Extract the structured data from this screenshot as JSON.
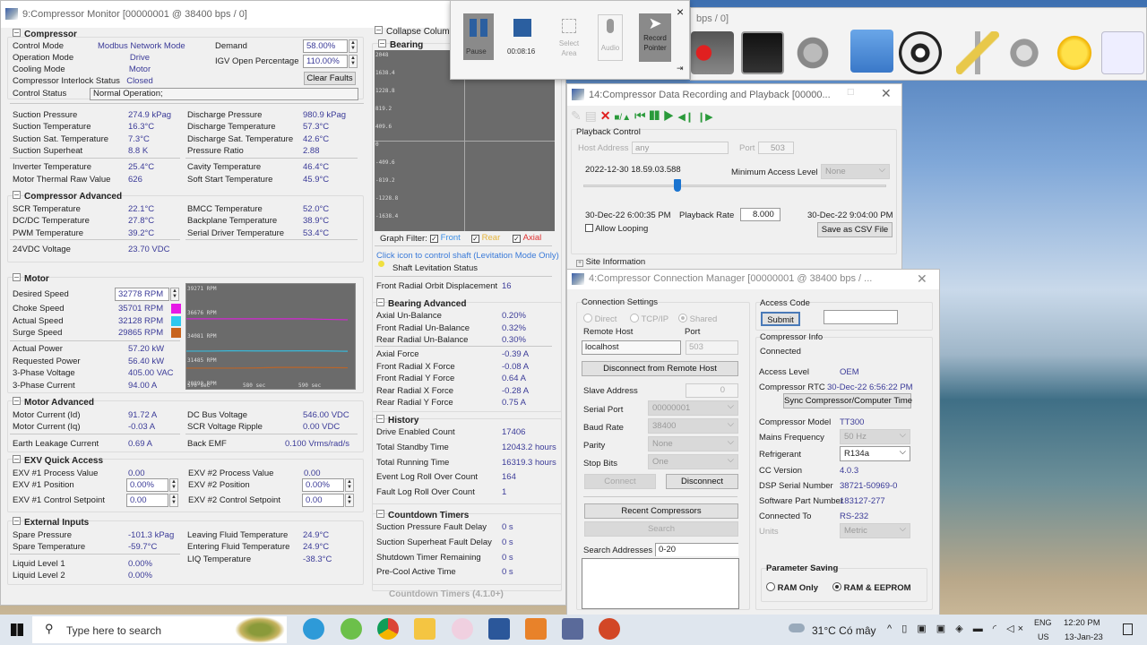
{
  "main": {
    "title": "9:Compressor Monitor [00000001 @ 38400 bps / 0]",
    "collapse_column": "Collapse Column",
    "compressor": {
      "header": "Compressor",
      "modes": [
        {
          "label": "Control Mode",
          "value": "Modbus Network Mode"
        },
        {
          "label": "Operation Mode",
          "value": "Drive"
        },
        {
          "label": "Cooling Mode",
          "value": "Motor"
        },
        {
          "label": "Compressor Interlock Status",
          "value": "Closed"
        }
      ],
      "demand_label": "Demand",
      "demand_value": "58.00%",
      "igv_label": "IGV Open Percentage",
      "igv_value": "110.00%",
      "clear_faults": "Clear Faults",
      "control_status_label": "Control Status",
      "control_status_value": "Normal Operation;",
      "left": [
        {
          "label": "Suction Pressure",
          "value": "274.9 kPag"
        },
        {
          "label": "Suction Temperature",
          "value": "16.3°C"
        },
        {
          "label": "Suction Sat. Temperature",
          "value": "7.3°C"
        },
        {
          "label": "Suction Superheat",
          "value": "8.8 K"
        },
        {
          "label": "Inverter Temperature",
          "value": "25.4°C"
        },
        {
          "label": "Motor Thermal Raw Value",
          "value": "626"
        }
      ],
      "right": [
        {
          "label": "Discharge Pressure",
          "value": "980.9 kPag"
        },
        {
          "label": "Discharge Temperature",
          "value": "57.3°C"
        },
        {
          "label": "Discharge Sat. Temperature",
          "value": "42.6°C"
        },
        {
          "label": "Pressure Ratio",
          "value": "2.88"
        },
        {
          "label": "Cavity Temperature",
          "value": "46.4°C"
        },
        {
          "label": "Soft Start Temperature",
          "value": "45.9°C"
        }
      ]
    },
    "compressor_advanced": {
      "header": "Compressor Advanced",
      "left": [
        {
          "label": "SCR Temperature",
          "value": "22.1°C"
        },
        {
          "label": "DC/DC Temperature",
          "value": "27.8°C"
        },
        {
          "label": "PWM Temperature",
          "value": "39.2°C"
        },
        {
          "label": "24VDC Voltage",
          "value": "23.70 VDC"
        }
      ],
      "right": [
        {
          "label": "BMCC Temperature",
          "value": "52.0°C"
        },
        {
          "label": "Backplane Temperature",
          "value": "38.9°C"
        },
        {
          "label": "Serial Driver Temperature",
          "value": "53.4°C"
        }
      ]
    },
    "motor": {
      "header": "Motor",
      "desired_label": "Desired Speed",
      "desired_value": "32778 RPM",
      "speeds": [
        {
          "label": "Choke Speed",
          "value": "35701 RPM",
          "color": "#e619e6"
        },
        {
          "label": "Actual Speed",
          "value": "32128 RPM",
          "color": "#2ec8ef"
        },
        {
          "label": "Surge Speed",
          "value": "29865 RPM",
          "color": "#c8641e"
        }
      ],
      "power": [
        {
          "label": "Actual Power",
          "value": "57.20 kW"
        },
        {
          "label": "Requested Power",
          "value": "56.40 kW"
        },
        {
          "label": "3-Phase Voltage",
          "value": "405.00 VAC"
        },
        {
          "label": "3-Phase Current",
          "value": "94.00 A"
        }
      ],
      "chart": {
        "y_ticks": [
          "39271 RPM",
          "36676 RPM",
          "34081 RPM",
          "31485 RPM",
          "28890 RPM"
        ],
        "x_ticks": [
          "570 sec",
          "580 sec",
          "590 sec"
        ],
        "ylim": [
          28890,
          39271
        ],
        "series": [
          {
            "name": "Choke Speed",
            "values": [
              35950,
              35950,
              35950,
              35950,
              35950,
              35950,
              35900,
              35850
            ]
          },
          {
            "name": "Actual Speed",
            "values": [
              32420,
              32420,
              32460,
              32440,
              32440,
              32450,
              32440,
              32400
            ]
          },
          {
            "name": "Surge Speed",
            "values": [
              30560,
              30560,
              30560,
              30580,
              30640,
              30640,
              30620,
              30600
            ]
          }
        ]
      }
    },
    "motor_advanced": {
      "header": "Motor Advanced",
      "left": [
        {
          "label": "Motor Current (Id)",
          "value": "91.72 A"
        },
        {
          "label": "Motor Current (Iq)",
          "value": "-0.03 A"
        },
        {
          "label": "Earth Leakage Current",
          "value": "0.69 A"
        }
      ],
      "right": [
        {
          "label": "DC Bus Voltage",
          "value": "546.00 VDC"
        },
        {
          "label": "SCR Voltage Ripple",
          "value": "0.00 VDC"
        },
        {
          "label": "Back EMF",
          "value": "0.100 Vrms/rad/s"
        }
      ]
    },
    "exv": {
      "header": "EXV Quick Access",
      "left": [
        {
          "label": "EXV #1 Process Value",
          "value": "0.00"
        },
        {
          "label": "EXV #1 Position",
          "value": "0.00%"
        },
        {
          "label": "EXV #1 Control Setpoint",
          "value": "0.00"
        }
      ],
      "right": [
        {
          "label": "EXV #2 Process Value",
          "value": "0.00"
        },
        {
          "label": "EXV #2 Position",
          "value": "0.00%"
        },
        {
          "label": "EXV #2 Control Setpoint",
          "value": "0.00"
        }
      ]
    },
    "external": {
      "header": "External Inputs",
      "left": [
        {
          "label": "Spare Pressure",
          "value": "-101.3 kPag"
        },
        {
          "label": "Spare Temperature",
          "value": "-59.7°C"
        },
        {
          "label": "Liquid Level 1",
          "value": "0.00%"
        },
        {
          "label": "Liquid Level 2",
          "value": "0.00%"
        }
      ],
      "right": [
        {
          "label": "Leaving Fluid Temperature",
          "value": "24.9°C"
        },
        {
          "label": "Entering Fluid Temperature",
          "value": "24.9°C"
        },
        {
          "label": "LIQ Temperature",
          "value": "-38.3°C"
        }
      ]
    },
    "bearing": {
      "header": "Bearing",
      "y_ticks": [
        "2048",
        "1638.4",
        "1228.8",
        "819.2",
        "409.6",
        "0",
        "-409.6",
        "-819.2",
        "-1228.8",
        "-1638.4"
      ],
      "graph_filter": "Graph Filter:",
      "filters": [
        {
          "label": "Front",
          "checked": true,
          "color": "#3a8ee6"
        },
        {
          "label": "Rear",
          "checked": true,
          "color": "#e6b43a"
        },
        {
          "label": "Axial",
          "checked": true,
          "color": "#e03030"
        }
      ],
      "control_link": "Click icon to control shaft (Levitation Mode Only)",
      "levitation_status": "Shaft Levitation Status",
      "orbit_label": "Front Radial Orbit Displacement",
      "orbit_value": "16"
    },
    "bearing_advanced": {
      "header": "Bearing Advanced",
      "rows": [
        {
          "label": "Axial Un-Balance",
          "value": "0.20%"
        },
        {
          "label": "Front Radial Un-Balance",
          "value": "0.32%"
        },
        {
          "label": "Rear Radial Un-Balance",
          "value": "0.30%"
        },
        {
          "label": "Axial Force",
          "value": "-0.39 A"
        },
        {
          "label": "Front Radial X Force",
          "value": "-0.08 A"
        },
        {
          "label": "Front Radial Y Force",
          "value": "0.64 A"
        },
        {
          "label": "Rear Radial X Force",
          "value": "-0.28 A"
        },
        {
          "label": "Rear Radial Y Force",
          "value": "0.75 A"
        }
      ]
    },
    "history": {
      "header": "History",
      "rows": [
        {
          "label": "Drive Enabled Count",
          "value": "17406"
        },
        {
          "label": "Total Standby Time",
          "value": "12043.2 hours"
        },
        {
          "label": "Total Running Time",
          "value": "16319.3 hours"
        },
        {
          "label": "Event Log Roll Over Count",
          "value": "164"
        },
        {
          "label": "Fault Log Roll Over Count",
          "value": "1"
        }
      ]
    },
    "countdown": {
      "header": "Countdown Timers",
      "rows": [
        {
          "label": "Suction Pressure Fault Delay",
          "value": "0 s"
        },
        {
          "label": "Suction Superheat Fault Delay",
          "value": "0 s"
        },
        {
          "label": "Shutdown Timer Remaining",
          "value": "0 s"
        },
        {
          "label": "Pre-Cool Active Time",
          "value": "0 s"
        }
      ],
      "v41_header": "Countdown Timers (4.1.0+)"
    }
  },
  "recorder": {
    "pause": "Pause",
    "time": "00:08:16",
    "select_area": "Select Area",
    "audio": "Audio",
    "record_pointer": "Record Pointer",
    "close": "×"
  },
  "tools_window": {
    "title_tail": "bps / 0]"
  },
  "playback": {
    "title": "14:Compressor Data Recording and Playback [00000...",
    "group": "Playback Control",
    "host_label": "Host Address",
    "host_value": "any",
    "port_label": "Port",
    "port_value": "503",
    "current_time": "2022-12-30 18.59.03.588",
    "min_access_label": "Minimum Access Level",
    "min_access_value": "None",
    "position": 0.31,
    "start": "30-Dec-22 6:00:35 PM",
    "rate_label": "Playback Rate",
    "rate_value": "8.000",
    "end": "30-Dec-22 9:04:00 PM",
    "allow_looping": "Allow Looping",
    "save_csv": "Save as CSV File",
    "site_info": "Site Information"
  },
  "connection": {
    "title": "4:Compressor Connection Manager [00000001 @ 38400 bps / ...",
    "settings": "Connection Settings",
    "direct": "Direct",
    "tcpip": "TCP/IP",
    "shared": "Shared",
    "remote_host_label": "Remote Host",
    "remote_host_value": "localhost",
    "port_label": "Port",
    "port_value": "503",
    "disconnect_remote": "Disconnect from Remote Host",
    "slave_label": "Slave Address",
    "slave_value": "0",
    "serial_port_label": "Serial Port",
    "serial_port_value": "00000001",
    "baud_label": "Baud Rate",
    "baud_value": "38400",
    "parity_label": "Parity",
    "parity_value": "None",
    "stop_bits_label": "Stop Bits",
    "stop_bits_value": "One",
    "connect": "Connect",
    "disconnect": "Disconnect",
    "recent": "Recent Compressors",
    "search": "Search",
    "search_addr_label": "Search Addresses",
    "search_addr_value": "0-20",
    "access_code": "Access Code",
    "submit": "Submit",
    "info": "Compressor Info",
    "connected": "Connected",
    "access_level_label": "Access Level",
    "access_level_value": "OEM",
    "rtc_label": "Compressor RTC",
    "rtc_value": "30-Dec-22 6:56:22 PM",
    "sync": "Sync Compressor/Computer Time",
    "model_label": "Compressor Model",
    "model_value": "TT300",
    "mains_label": "Mains Frequency",
    "mains_value": "50 Hz",
    "refrigerant_label": "Refrigerant",
    "refrigerant_value": "R134a",
    "cc_label": "CC Version",
    "cc_value": "4.0.3",
    "dsp_label": "DSP Serial Number",
    "dsp_value": "38721-50969-0",
    "swpn_label": "Software Part Number",
    "swpn_value": "183127-277",
    "connected_to_label": "Connected To",
    "connected_to_value": "RS-232",
    "units_label": "Units",
    "units_value": "Metric",
    "param_saving": "Parameter Saving",
    "ram_only": "RAM Only",
    "ram_eeprom": "RAM & EEPROM"
  },
  "taskbar": {
    "search_placeholder": "Type here to search",
    "weather": "31°C  Có mây",
    "lang1": "ENG",
    "lang2": "US",
    "time": "12:20 PM",
    "date": "13-Jan-23"
  }
}
